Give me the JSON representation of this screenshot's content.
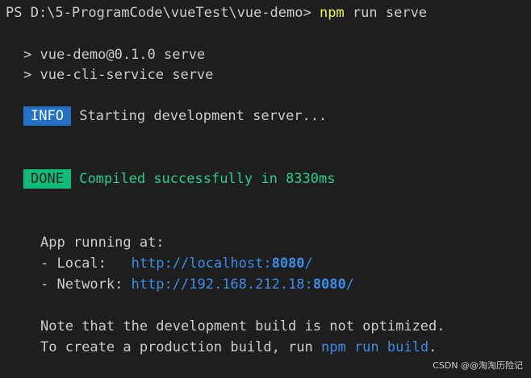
{
  "prompt": {
    "path": "PS D:\\5-ProgramCode\\vueTest\\vue-demo>",
    "command": "npm",
    "args": "run serve"
  },
  "script_lines": [
    "> vue-demo@0.1.0 serve",
    "> vue-cli-service serve"
  ],
  "info": {
    "badge": "INFO",
    "message": "Starting development server..."
  },
  "done": {
    "badge": "DONE",
    "message": "Compiled successfully in 8330ms"
  },
  "app": {
    "heading": "App running at:",
    "local_label": "- Local:   ",
    "local_url_prefix": "http://localhost:",
    "local_port": "8080",
    "local_url_suffix": "/",
    "network_label": "- Network: ",
    "network_url_prefix": "http://192.168.212.18:",
    "network_port": "8080",
    "network_url_suffix": "/"
  },
  "note": {
    "line1": "Note that the development build is not optimized.",
    "line2_prefix": "To create a production build, run ",
    "line2_command": "npm run build",
    "line2_suffix": "."
  },
  "watermark": "CSDN @@淘淘历险记",
  "colors": {
    "background": "#1e1e1e",
    "text": "#cccccc",
    "command_yellow": "#f5f543",
    "link_blue": "#3b8eea",
    "success_green": "#23d18b",
    "info_badge": "#2472c8",
    "done_badge": "#0dbc79"
  }
}
